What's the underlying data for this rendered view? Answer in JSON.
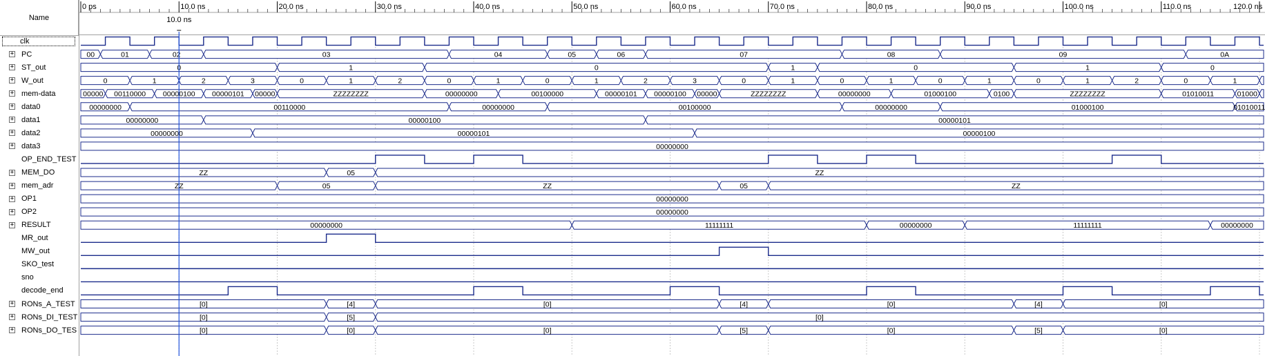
{
  "name_header": "Name",
  "timeline": {
    "ticks": [
      "0 ps",
      "10.0 ns",
      "20.0 ns",
      "30.0 ns",
      "40.0 ns",
      "50.0 ns",
      "60.0 ns",
      "70.0 ns",
      "80.0 ns",
      "90.0 ns",
      "100.0 ns",
      "110.0 ns",
      "120.0 ns"
    ],
    "cursor_label": "10.0 ns",
    "cursor_time_ns": 10.0
  },
  "colors": {
    "wave": "#1a2a8a",
    "cursor": "#2255dd",
    "grid": "#c8c8c8",
    "text": "#000000"
  },
  "signals": [
    {
      "name": "clk",
      "kind": "clock",
      "expandable": false,
      "period_ns": 5,
      "high_start_ns": 2.5
    },
    {
      "name": "PC",
      "kind": "bus",
      "expandable": true,
      "segments": [
        [
          0,
          2,
          "00"
        ],
        [
          2,
          7,
          "01"
        ],
        [
          7,
          12.5,
          "02"
        ],
        [
          12.5,
          37.5,
          "03"
        ],
        [
          37.5,
          47.5,
          "04"
        ],
        [
          47.5,
          52.5,
          "05"
        ],
        [
          52.5,
          57.5,
          "06"
        ],
        [
          57.5,
          77.5,
          "07"
        ],
        [
          77.5,
          87.5,
          "08"
        ],
        [
          87.5,
          112.5,
          "09"
        ],
        [
          112.5,
          122,
          "0A"
        ]
      ]
    },
    {
      "name": "ST_out",
      "kind": "bus",
      "expandable": true,
      "segments": [
        [
          0,
          20,
          "0"
        ],
        [
          20,
          35,
          "1"
        ],
        [
          35,
          70,
          "0"
        ],
        [
          70,
          75,
          "1"
        ],
        [
          75,
          95,
          "0"
        ],
        [
          95,
          110,
          "1"
        ],
        [
          110,
          122,
          "0"
        ]
      ]
    },
    {
      "name": "W_out",
      "kind": "bus",
      "expandable": true,
      "segments": [
        [
          0,
          5,
          "0"
        ],
        [
          5,
          10,
          "1"
        ],
        [
          10,
          15,
          "2"
        ],
        [
          15,
          20,
          "3"
        ],
        [
          20,
          25,
          "0"
        ],
        [
          25,
          30,
          "1"
        ],
        [
          30,
          35,
          "2"
        ],
        [
          35,
          40,
          "0"
        ],
        [
          40,
          45,
          "1"
        ],
        [
          45,
          50,
          "0"
        ],
        [
          50,
          55,
          "1"
        ],
        [
          55,
          60,
          "2"
        ],
        [
          60,
          65,
          "3"
        ],
        [
          65,
          70,
          "0"
        ],
        [
          70,
          75,
          "1"
        ],
        [
          75,
          80,
          "0"
        ],
        [
          80,
          85,
          "1"
        ],
        [
          85,
          90,
          "0"
        ],
        [
          90,
          95,
          "1"
        ],
        [
          95,
          100,
          "0"
        ],
        [
          100,
          105,
          "1"
        ],
        [
          105,
          110,
          "2"
        ],
        [
          110,
          115,
          "0"
        ],
        [
          115,
          120,
          "1"
        ],
        [
          120,
          122,
          ""
        ]
      ]
    },
    {
      "name": "mem-data",
      "kind": "bus",
      "expandable": true,
      "segments": [
        [
          0,
          2.5,
          "00000"
        ],
        [
          2.5,
          7.5,
          "00110000"
        ],
        [
          7.5,
          12.5,
          "00000100"
        ],
        [
          12.5,
          17.5,
          "00000101"
        ],
        [
          17.5,
          20,
          "00000"
        ],
        [
          20,
          35,
          "ZZZZZZZZ"
        ],
        [
          35,
          42.5,
          "00000000"
        ],
        [
          42.5,
          52.5,
          "00100000"
        ],
        [
          52.5,
          57.5,
          "00000101"
        ],
        [
          57.5,
          62.5,
          "00000100"
        ],
        [
          62.5,
          65,
          "00000"
        ],
        [
          65,
          75,
          "ZZZZZZZZ"
        ],
        [
          75,
          82.5,
          "00000000"
        ],
        [
          82.5,
          92.5,
          "01000100"
        ],
        [
          92.5,
          95,
          "0100"
        ],
        [
          95,
          110,
          "ZZZZZZZZ"
        ],
        [
          110,
          117.5,
          "01010011"
        ],
        [
          117.5,
          120,
          "01000"
        ],
        [
          120,
          122,
          ""
        ]
      ]
    },
    {
      "name": "data0",
      "kind": "bus",
      "expandable": true,
      "segments": [
        [
          0,
          5,
          "00000000"
        ],
        [
          5,
          37.5,
          "00110000"
        ],
        [
          37.5,
          47.5,
          "00000000"
        ],
        [
          47.5,
          77.5,
          "00100000"
        ],
        [
          77.5,
          87.5,
          "00000000"
        ],
        [
          87.5,
          117.5,
          "01000100"
        ],
        [
          117.5,
          122,
          "01010011"
        ]
      ]
    },
    {
      "name": "data1",
      "kind": "bus",
      "expandable": true,
      "segments": [
        [
          0,
          12.5,
          "00000000"
        ],
        [
          12.5,
          57.5,
          "00000100"
        ],
        [
          57.5,
          122,
          "00000101"
        ]
      ]
    },
    {
      "name": "data2",
      "kind": "bus",
      "expandable": true,
      "segments": [
        [
          0,
          17.5,
          "00000000"
        ],
        [
          17.5,
          62.5,
          "00000101"
        ],
        [
          62.5,
          122,
          "00000100"
        ]
      ]
    },
    {
      "name": "data3",
      "kind": "bus",
      "expandable": true,
      "segments": [
        [
          0,
          122,
          "00000000"
        ]
      ]
    },
    {
      "name": "OP_END_TEST",
      "kind": "bit",
      "expandable": false,
      "highs": [
        [
          30,
          35
        ],
        [
          40,
          45
        ],
        [
          70,
          75
        ],
        [
          80,
          85
        ],
        [
          105,
          110
        ]
      ]
    },
    {
      "name": "MEM_DO",
      "kind": "bus",
      "expandable": true,
      "segments": [
        [
          0,
          25,
          "ZZ"
        ],
        [
          25,
          30,
          "05"
        ],
        [
          30,
          122,
          "ZZ"
        ]
      ]
    },
    {
      "name": "mem_adr",
      "kind": "bus",
      "expandable": true,
      "segments": [
        [
          0,
          20,
          "ZZ"
        ],
        [
          20,
          30,
          "05"
        ],
        [
          30,
          65,
          "ZZ"
        ],
        [
          65,
          70,
          "05"
        ],
        [
          70,
          122,
          "ZZ"
        ]
      ]
    },
    {
      "name": "OP1",
      "kind": "bus",
      "expandable": true,
      "segments": [
        [
          0,
          122,
          "00000000"
        ]
      ]
    },
    {
      "name": "OP2",
      "kind": "bus",
      "expandable": true,
      "segments": [
        [
          0,
          122,
          "00000000"
        ]
      ]
    },
    {
      "name": "RESULT",
      "kind": "bus",
      "expandable": true,
      "segments": [
        [
          0,
          50,
          "00000000"
        ],
        [
          50,
          80,
          "11111111"
        ],
        [
          80,
          90,
          "00000000"
        ],
        [
          90,
          115,
          "11111111"
        ],
        [
          115,
          122,
          "00000000"
        ]
      ]
    },
    {
      "name": "MR_out",
      "kind": "bit",
      "expandable": false,
      "highs": [
        [
          25,
          30
        ]
      ]
    },
    {
      "name": "MW_out",
      "kind": "bit",
      "expandable": false,
      "highs": [
        [
          65,
          70
        ]
      ]
    },
    {
      "name": "SKO_test",
      "kind": "bit",
      "expandable": false,
      "highs": []
    },
    {
      "name": "sno",
      "kind": "bit",
      "expandable": false,
      "highs": []
    },
    {
      "name": "decode_end",
      "kind": "bit",
      "expandable": false,
      "highs": [
        [
          15,
          20
        ],
        [
          40,
          45
        ],
        [
          60,
          65
        ],
        [
          80,
          85
        ],
        [
          100,
          105
        ],
        [
          115,
          120
        ]
      ]
    },
    {
      "name": "RONs_A_TEST",
      "kind": "bus",
      "expandable": true,
      "segments": [
        [
          0,
          25,
          "[0]"
        ],
        [
          25,
          30,
          "[4]"
        ],
        [
          30,
          65,
          "[0]"
        ],
        [
          65,
          70,
          "[4]"
        ],
        [
          70,
          95,
          "[0]"
        ],
        [
          95,
          100,
          "[4]"
        ],
        [
          100,
          122,
          "[0]"
        ]
      ]
    },
    {
      "name": "RONs_DI_TEST",
      "kind": "bus",
      "expandable": true,
      "segments": [
        [
          0,
          25,
          "[0]"
        ],
        [
          25,
          30,
          "[5]"
        ],
        [
          30,
          122,
          "[0]"
        ]
      ]
    },
    {
      "name": "RONs_DO_TES",
      "kind": "bus",
      "expandable": true,
      "segments": [
        [
          0,
          25,
          "[0]"
        ],
        [
          25,
          30,
          "[0]"
        ],
        [
          30,
          65,
          "[0]"
        ],
        [
          65,
          70,
          "[5]"
        ],
        [
          70,
          95,
          "[0]"
        ],
        [
          95,
          100,
          "[5]"
        ],
        [
          100,
          122,
          "[0]"
        ]
      ]
    }
  ]
}
